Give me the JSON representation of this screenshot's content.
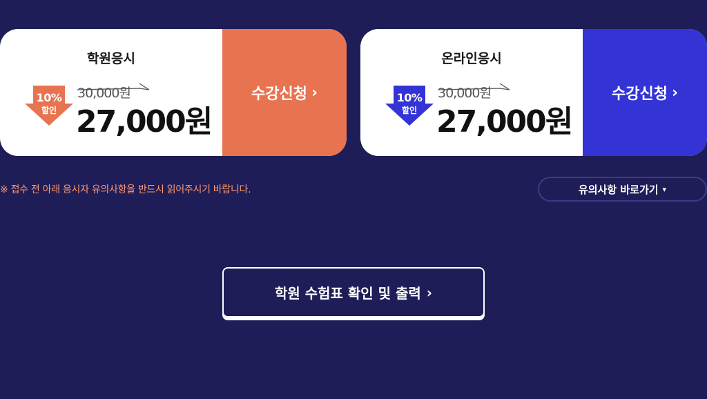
{
  "cards": [
    {
      "title": "학원응시",
      "discount_percent": "10%",
      "discount_label": "할인",
      "original_price": "30,000원",
      "price": "27,000원",
      "apply_label": "수강신청",
      "accent_color": "#e87350"
    },
    {
      "title": "온라인응시",
      "discount_percent": "10%",
      "discount_label": "할인",
      "original_price": "30,000원",
      "price": "27,000원",
      "apply_label": "수강신청",
      "accent_color": "#3333d6"
    }
  ],
  "notice_text": "※ 접수 전 아래 응시자 유의사항을 반드시 읽어주시기 바랍니다.",
  "precaution_button_label": "유의사항 바로가기",
  "ticket_button_label": "학원 수험표 확인 및 출력",
  "icons": {
    "apply_chevron": "chevron-right-icon",
    "precaution_chevron": "chevron-down-icon",
    "ticket_chevron": "chevron-right-icon"
  },
  "colors": {
    "background": "#1f1d57",
    "notice": "#ff9a72"
  }
}
